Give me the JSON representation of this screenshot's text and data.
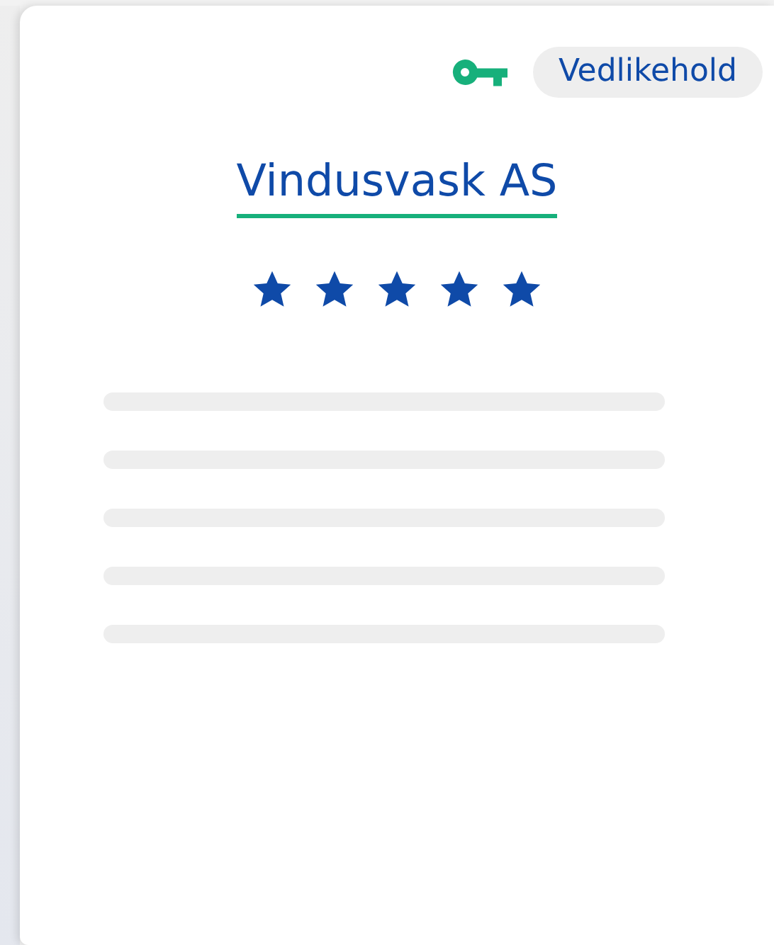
{
  "badge": {
    "label": "Vedlikehold"
  },
  "company": {
    "name": "Vindusvask AS",
    "stars": 5
  }
}
